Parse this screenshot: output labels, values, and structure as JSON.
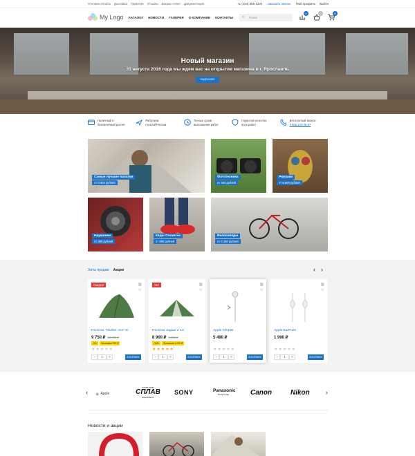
{
  "topbar": {
    "links": [
      "Условия оплаты",
      "Доставка",
      "Гарантия",
      "Отзывы",
      "Вопрос-ответ",
      "Документация"
    ],
    "phone": "+1 (234) 555-1234",
    "callback": "Заказать звонок",
    "profile": "Мой профиль",
    "logout": "Выйти"
  },
  "header": {
    "logo": "My Logo",
    "nav": [
      "КАТАЛОГ",
      "НОВОСТИ",
      "ГАЛЕРЕЯ",
      "О КОМПАНИИ",
      "КОНТАКТЫ"
    ],
    "search_placeholder": "Поиск",
    "badges": {
      "compare": "0",
      "favorites": "0",
      "cart": "0"
    }
  },
  "hero": {
    "title": "Новый магазин",
    "subtitle": "31 августа 2016 года мы ждем вас на открытие магазина в г. Ярославль",
    "button": "ПОДРОБНЕЕ"
  },
  "features": [
    {
      "icon": "card-icon",
      "line1": "Наличный и",
      "line2": "безналичный расчет"
    },
    {
      "icon": "plane-icon",
      "line1": "Работаем",
      "line2": "по всей России"
    },
    {
      "icon": "clock-icon",
      "line1": "Точные сроки",
      "line2": "выполнения работ"
    },
    {
      "icon": "shield-icon",
      "line1": "Гарантия качества",
      "line2": "всех работ"
    },
    {
      "icon": "phone-icon",
      "line1": "Бесплатный звонок",
      "line2": "8 800 123-45-67"
    }
  ],
  "categories": [
    {
      "name": "Самые лучшие палатки",
      "price": "от 8 900 рублей"
    },
    {
      "name": "Фототехника",
      "price": "от 350 рублей"
    },
    {
      "name": "Рюкзаки",
      "price": "от 8 900 рублей"
    },
    {
      "name": "Наушники",
      "price": "от 380 рублей"
    },
    {
      "name": "Кеды Converse",
      "price": "от 899 рублей"
    },
    {
      "name": "Велосипеды",
      "price": "от 6 490 рублей"
    }
  ],
  "products": {
    "tabs": [
      "Хиты продаж",
      "Акции"
    ],
    "buy_label": "В КОРЗИНУ",
    "items": [
      {
        "badge": "Скидка!",
        "badge_color": "#e53935",
        "name": "Палатка \"Shelter one\" Si",
        "price": "9 750 ₽",
        "old": "10 000 ₽",
        "tag1": "-5%",
        "tag2": "Экономия 750 ₽",
        "stars": "★★★★★",
        "rated": false,
        "qty": "1"
      },
      {
        "badge": "Хит",
        "badge_color": "#e53935",
        "name": "Палатка Jaguar 2 v.2",
        "price": "8 900 ₽",
        "old": "9 900 ₽",
        "tag1": "-10%",
        "tag2": "Экономия 1 000 ₽",
        "stars": "★★★★★",
        "rated": true,
        "qty": "1"
      },
      {
        "badge": "",
        "badge_color": "",
        "name": "Apple iVE186",
        "price": "5 490 ₽",
        "old": "",
        "tag1": "",
        "tag2": "",
        "stars": "★★★★★",
        "rated": false,
        "qty": "1"
      },
      {
        "badge": "",
        "badge_color": "",
        "name": "Apple EarPods",
        "price": "1 990 ₽",
        "old": "",
        "tag1": "",
        "tag2": "",
        "stars": "★★★★★",
        "rated": false,
        "qty": "1"
      }
    ]
  },
  "brands": [
    "Apple",
    "СПЛАВ",
    "SONY",
    "Panasonic",
    "Canon",
    "Nikon"
  ],
  "brand_captions": {
    "splav_top": "КОМПАНИЯ",
    "splav_url": "www.splav.ru",
    "panasonic_sub": "ideas for life"
  },
  "news": {
    "title": "Новости и акции"
  },
  "colors": {
    "accent": "#1a73c9",
    "sale": "#e53935",
    "tag": "#ffd200"
  }
}
